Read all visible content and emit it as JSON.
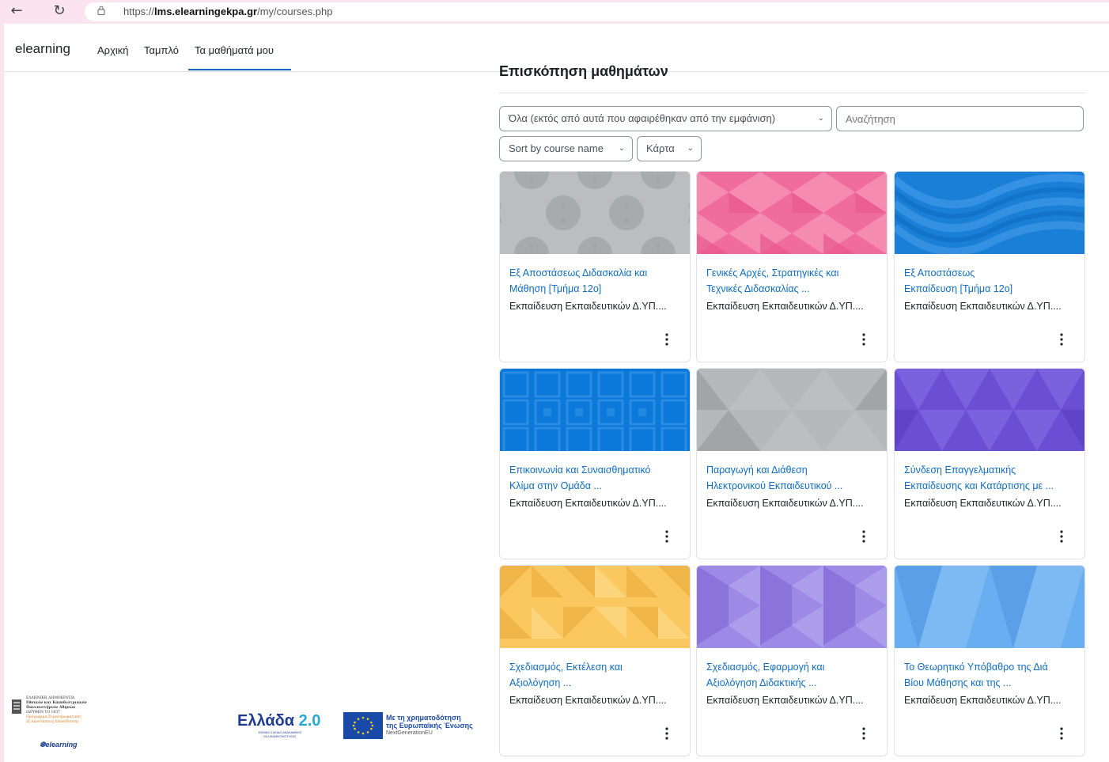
{
  "browser": {
    "url_prefix": "https://",
    "url_host": "lms.elearningekpa.gr",
    "url_path": "/my/courses.php"
  },
  "navbar": {
    "brand": "elearning",
    "links": [
      "Αρχική",
      "Ταμπλό",
      "Τα μαθήματά μου"
    ],
    "active_index": 2
  },
  "main": {
    "heading": "Επισκόπηση μαθημάτων",
    "filter_label": "Όλα (εκτός από αυτά που αφαιρέθηκαν από την εμφάνιση)",
    "search_placeholder": "Αναζήτηση",
    "sort_label": "Sort by course name",
    "view_label": "Κάρτα",
    "courses": [
      {
        "title_line1": "Εξ Αποστάσεως Διδασκαλία και",
        "title_line2": "Μάθηση [Τμήμα 12ο]",
        "category": "Εκπαίδευση Εκπαιδευτικών Δ.ΥΠ....",
        "pattern": "gray-circles"
      },
      {
        "title_line1": "Γενικές Αρχές, Στρατηγικές και",
        "title_line2": "Τεχνικές Διδασκαλίας ...",
        "category": "Εκπαίδευση Εκπαιδευτικών Δ.ΥΠ....",
        "pattern": "pink-triangles"
      },
      {
        "title_line1": "Εξ Αποστάσεως",
        "title_line2": "Εκπαίδευση [Τμήμα 12ο]",
        "category": "Εκπαίδευση Εκπαιδευτικών Δ.ΥΠ....",
        "pattern": "blue-waves"
      },
      {
        "title_line1": "Επικοινωνία και Συναισθηματικό",
        "title_line2": "Κλίμα στην Ομάδα ...",
        "category": "Εκπαίδευση Εκπαιδευτικών Δ.ΥΠ....",
        "pattern": "blue-squares"
      },
      {
        "title_line1": "Παραγωγή και Διάθεση",
        "title_line2": "Ηλεκτρονικού Εκπαιδευτικού ...",
        "category": "Εκπαίδευση Εκπαιδευτικών Δ.ΥΠ....",
        "pattern": "gray-triangles"
      },
      {
        "title_line1": "Σύνδεση Επαγγελματικής",
        "title_line2": "Εκπαίδευσης και Κατάρτισης με ...",
        "category": "Εκπαίδευση Εκπαιδευτικών Δ.ΥΠ....",
        "pattern": "purple-triangles"
      },
      {
        "title_line1": "Σχεδιασμός, Εκτέλεση και",
        "title_line2": "Αξιολόγηση ...",
        "category": "Εκπαίδευση Εκπαιδευτικών Δ.ΥΠ....",
        "pattern": "yellow-triangles"
      },
      {
        "title_line1": "Σχεδιασμός, Εφαρμογή και",
        "title_line2": "Αξιολόγηση Διδακτικής ...",
        "category": "Εκπαίδευση Εκπαιδευτικών Δ.ΥΠ....",
        "pattern": "lavender-hexagons"
      },
      {
        "title_line1": "Το Θεωρητικό Υπόβαθρο της Διά",
        "title_line2": "Βίου Μάθησης και της ...",
        "category": "Εκπαίδευση Εκπαιδευτικών Δ.ΥΠ....",
        "pattern": "lightblue-triangles"
      }
    ]
  },
  "footer": {
    "uoa_line1": "ΕΛΛΗΝΙΚΗ ΔΗΜΟΚΡΑΤΙΑ",
    "uoa_line2": "Εθνικόν και Καποδιστριακόν",
    "uoa_line3": "Πανεπιστήμιον Αθηνών",
    "uoa_line4": "ΙΔΡΥΘΕΝ ΤΟ 1837",
    "uoa_line5": "Πρόγραμμα Συμπληρωματικής",
    "uoa_line6": "εξ Αποστάσεως Εκπαίδευσης",
    "uoa_elearning": "elearning",
    "ellada_word": "Ελλάδα",
    "ellada_num": "2.0",
    "ellada_sub1": "ΕΘΝΙΚΟ ΣΧΕΔΙΟ ΑΝΑΚΑΜΨΗΣ",
    "ellada_sub2": "ΚΑΙ ΑΝΘΕΚΤΙΚΟΤΗΤΑΣ",
    "eu_line1": "Με τη χρηματοδότηση",
    "eu_line2": "της Ευρωπαϊκής Ένωσης",
    "eu_line3": "NextGenerationEU"
  },
  "colors": {
    "link": "#0f6cbf",
    "browser_chrome": "#fbe4ef",
    "border": "#dee2e6"
  }
}
